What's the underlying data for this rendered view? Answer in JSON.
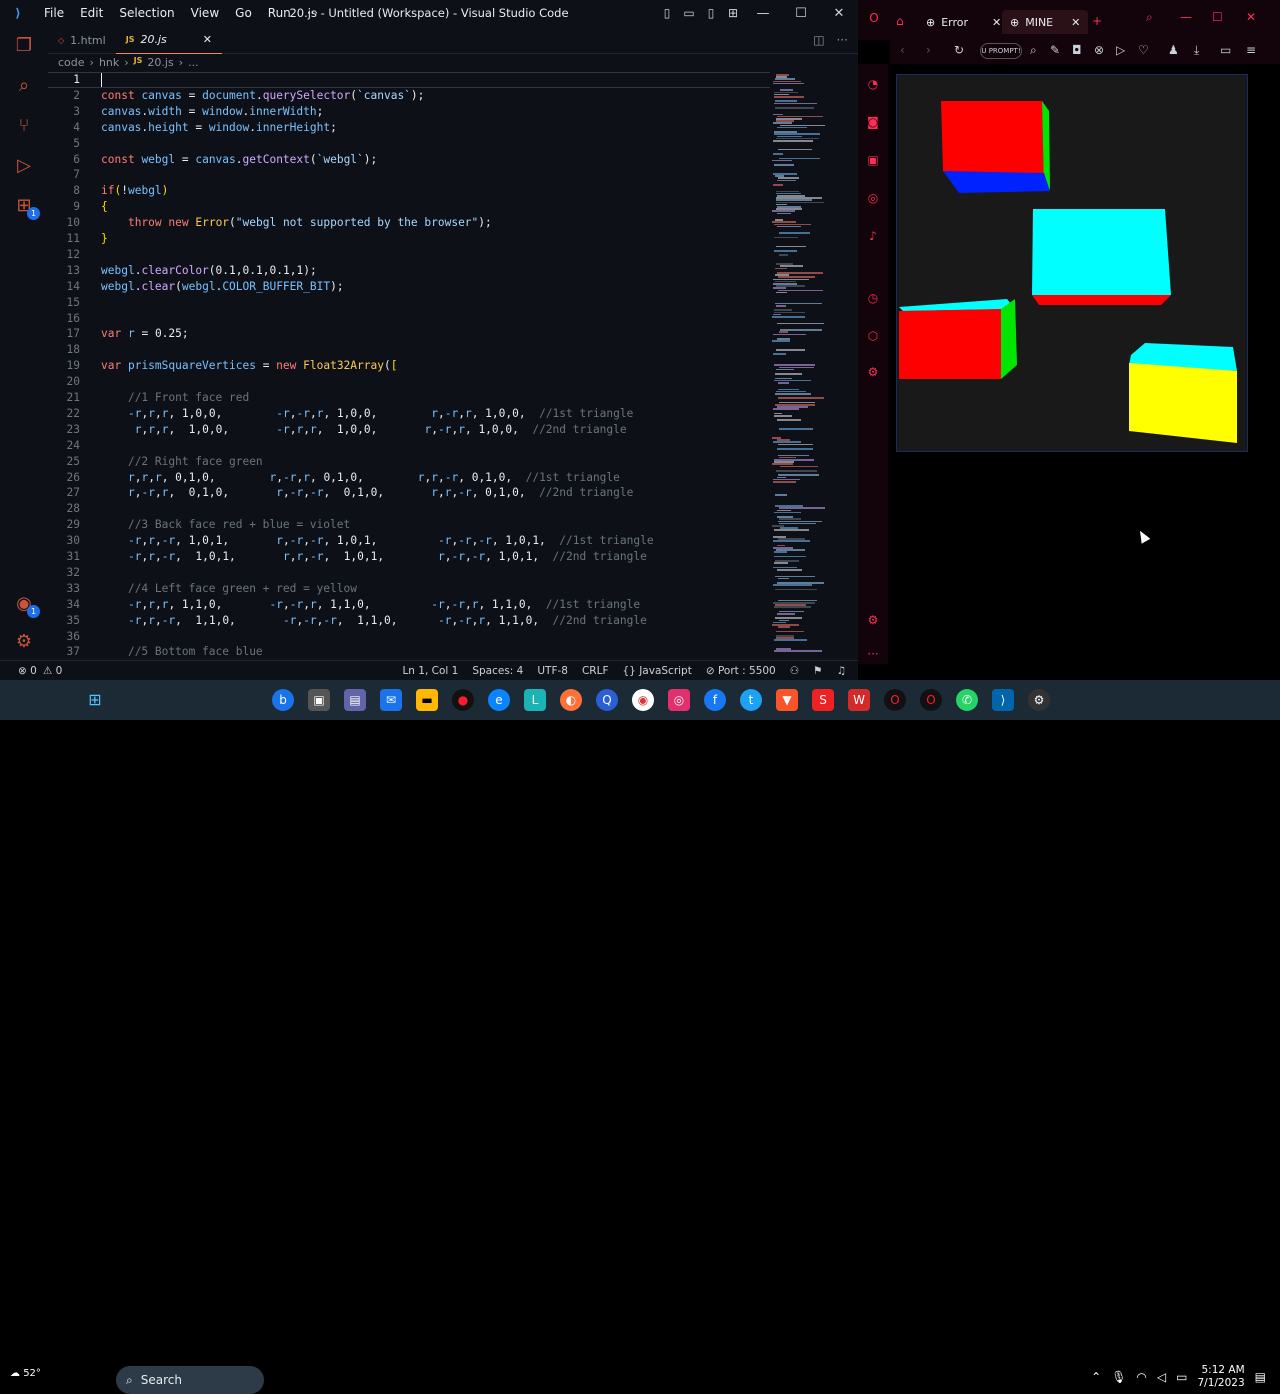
{
  "vscode": {
    "menu": [
      "File",
      "Edit",
      "Selection",
      "View",
      "Go",
      "Run",
      "···"
    ],
    "window_title": "20.js - Untitled (Workspace) - Visual Studio Code",
    "tabs": [
      {
        "label": "1.html",
        "icon": "html-icon"
      },
      {
        "label": "20.js",
        "icon": "js-icon",
        "close": "✕"
      }
    ],
    "breadcrumb": [
      "code",
      "hnk",
      "JS",
      "20.js",
      "..."
    ],
    "status": {
      "errors": "⊗ 0",
      "warnings": "⚠ 0",
      "position": "Ln 1, Col 1",
      "spaces": "Spaces: 4",
      "encoding": "UTF-8",
      "eol": "CRLF",
      "language": "{} JavaScript",
      "port": "⊘ Port : 5500"
    }
  },
  "code_lines": [
    {
      "n": "1",
      "h": ""
    },
    {
      "n": "2",
      "h": "<span class='kw'>const</span> <span class='vr'>canvas</span> = <span class='vr'>document</span>.<span class='fn'>querySelector</span>(<span class='str'>`canvas`</span>);"
    },
    {
      "n": "3",
      "h": "<span class='vr'>canvas</span>.<span class='vr'>width</span> = <span class='vr'>window</span>.<span class='vr'>innerWidth</span>;"
    },
    {
      "n": "4",
      "h": "<span class='vr'>canvas</span>.<span class='vr'>height</span> = <span class='vr'>window</span>.<span class='vr'>innerHeight</span>;"
    },
    {
      "n": "5",
      "h": ""
    },
    {
      "n": "6",
      "h": "<span class='kw'>const</span> <span class='vr'>webgl</span> = <span class='vr'>canvas</span>.<span class='fn'>getContext</span>(<span class='str'>`webgl`</span>);"
    },
    {
      "n": "7",
      "h": ""
    },
    {
      "n": "8",
      "h": "<span class='kw'>if</span><span class='bk'>(</span>!<span class='vr'>webgl</span><span class='bk'>)</span>"
    },
    {
      "n": "9",
      "h": "<span class='bk'>{</span>"
    },
    {
      "n": "10",
      "h": "    <span class='kw'>throw</span> <span class='kw'>new</span> <span class='fy'>Error</span>(<span class='str'>\"webgl not supported by the browser\"</span>);"
    },
    {
      "n": "11",
      "h": "<span class='bk'>}</span>"
    },
    {
      "n": "12",
      "h": ""
    },
    {
      "n": "13",
      "h": "<span class='vr'>webgl</span>.<span class='fn'>clearColor</span>(<span class='num'>0.1</span>,<span class='num'>0.1</span>,<span class='num'>0.1</span>,<span class='num'>1</span>);"
    },
    {
      "n": "14",
      "h": "<span class='vr'>webgl</span>.<span class='fn'>clear</span>(<span class='vr'>webgl</span>.<span class='cn'>COLOR_BUFFER_BIT</span>);"
    },
    {
      "n": "15",
      "h": ""
    },
    {
      "n": "16",
      "h": ""
    },
    {
      "n": "17",
      "h": "<span class='kw'>var</span> <span class='vr'>r</span> = <span class='num'>0.25</span>;"
    },
    {
      "n": "18",
      "h": ""
    },
    {
      "n": "19",
      "h": "<span class='kw'>var</span> <span class='vr'>prismSquareVertices</span> = <span class='kw'>new</span> <span class='fy'>Float32Array</span>(<span class='bk'>[</span>"
    },
    {
      "n": "20",
      "h": ""
    },
    {
      "n": "21",
      "h": "    <span class='cm'>//1 Front face red</span>"
    },
    {
      "n": "22",
      "h": "    <span class='vr'>-r</span>,<span class='vr'>r</span>,<span class='vr'>r</span>, 1,0,0,        <span class='vr'>-r</span>,<span class='vr'>-r</span>,<span class='vr'>r</span>, 1,0,0,        <span class='vr'>r</span>,<span class='vr'>-r</span>,<span class='vr'>r</span>, 1,0,0,  <span class='cm'>//1st triangle</span>"
    },
    {
      "n": "23",
      "h": "     <span class='vr'>r</span>,<span class='vr'>r</span>,<span class='vr'>r</span>,  1,0,0,       <span class='vr'>-r</span>,<span class='vr'>r</span>,<span class='vr'>r</span>,  1,0,0,       <span class='vr'>r</span>,<span class='vr'>-r</span>,<span class='vr'>r</span>, 1,0,0,  <span class='cm'>//2nd triangle</span>"
    },
    {
      "n": "24",
      "h": ""
    },
    {
      "n": "25",
      "h": "    <span class='cm'>//2 Right face green</span>"
    },
    {
      "n": "26",
      "h": "    <span class='vr'>r</span>,<span class='vr'>r</span>,<span class='vr'>r</span>, 0,1,0,        <span class='vr'>r</span>,<span class='vr'>-r</span>,<span class='vr'>r</span>, 0,1,0,        <span class='vr'>r</span>,<span class='vr'>r</span>,<span class='vr'>-r</span>, 0,1,0,  <span class='cm'>//1st triangle</span>"
    },
    {
      "n": "27",
      "h": "    <span class='vr'>r</span>,<span class='vr'>-r</span>,<span class='vr'>r</span>,  0,1,0,       <span class='vr'>r</span>,<span class='vr'>-r</span>,<span class='vr'>-r</span>,  0,1,0,       <span class='vr'>r</span>,<span class='vr'>r</span>,<span class='vr'>-r</span>, 0,1,0,  <span class='cm'>//2nd triangle</span>"
    },
    {
      "n": "28",
      "h": ""
    },
    {
      "n": "29",
      "h": "    <span class='cm'>//3 Back face red + blue = violet</span>"
    },
    {
      "n": "30",
      "h": "    <span class='vr'>-r</span>,<span class='vr'>r</span>,<span class='vr'>-r</span>, 1,0,1,       <span class='vr'>r</span>,<span class='vr'>-r</span>,<span class='vr'>-r</span>, 1,0,1,         <span class='vr'>-r</span>,<span class='vr'>-r</span>,<span class='vr'>-r</span>, 1,0,1,  <span class='cm'>//1st triangle</span>"
    },
    {
      "n": "31",
      "h": "    <span class='vr'>-r</span>,<span class='vr'>r</span>,<span class='vr'>-r</span>,  1,0,1,       <span class='vr'>r</span>,<span class='vr'>r</span>,<span class='vr'>-r</span>,  1,0,1,        <span class='vr'>r</span>,<span class='vr'>-r</span>,<span class='vr'>-r</span>, 1,0,1,  <span class='cm'>//2nd triangle</span>"
    },
    {
      "n": "32",
      "h": ""
    },
    {
      "n": "33",
      "h": "    <span class='cm'>//4 Left face green + red = yellow</span>"
    },
    {
      "n": "34",
      "h": "    <span class='vr'>-r</span>,<span class='vr'>r</span>,<span class='vr'>r</span>, 1,1,0,       <span class='vr'>-r</span>,<span class='vr'>-r</span>,<span class='vr'>r</span>, 1,1,0,         <span class='vr'>-r</span>,<span class='vr'>-r</span>,<span class='vr'>r</span>, 1,1,0,  <span class='cm'>//1st triangle</span>"
    },
    {
      "n": "35",
      "h": "    <span class='vr'>-r</span>,<span class='vr'>r</span>,<span class='vr'>-r</span>,  1,1,0,       <span class='vr'>-r</span>,<span class='vr'>-r</span>,<span class='vr'>-r</span>,  1,1,0,      <span class='vr'>-r</span>,<span class='vr'>-r</span>,<span class='vr'>r</span>, 1,1,0,  <span class='cm'>//2nd triangle</span>"
    },
    {
      "n": "36",
      "h": ""
    },
    {
      "n": "37",
      "h": "    <span class='cm'>//5 Bottom face blue</span>"
    }
  ],
  "browser": {
    "tabs": [
      {
        "label": "Error",
        "close": "✕"
      },
      {
        "label": "MINE",
        "close": "✕"
      }
    ],
    "address_text": "U PROMPT!",
    "cubes": [
      {
        "front": "#ff0000",
        "side": "#00e600",
        "bottom": "#0022ff"
      },
      {
        "front": "#00ffff",
        "side": "#00ffff",
        "bottom": "#ff0000"
      },
      {
        "front": "#ff0000",
        "side": "#00e600",
        "top": "#00ffff"
      },
      {
        "front": "#ffff00",
        "top": "#00ffff"
      }
    ]
  },
  "taskbar": {
    "weather": "52°",
    "search": "Search",
    "time": "5:12 AM",
    "date": "7/1/2023"
  }
}
